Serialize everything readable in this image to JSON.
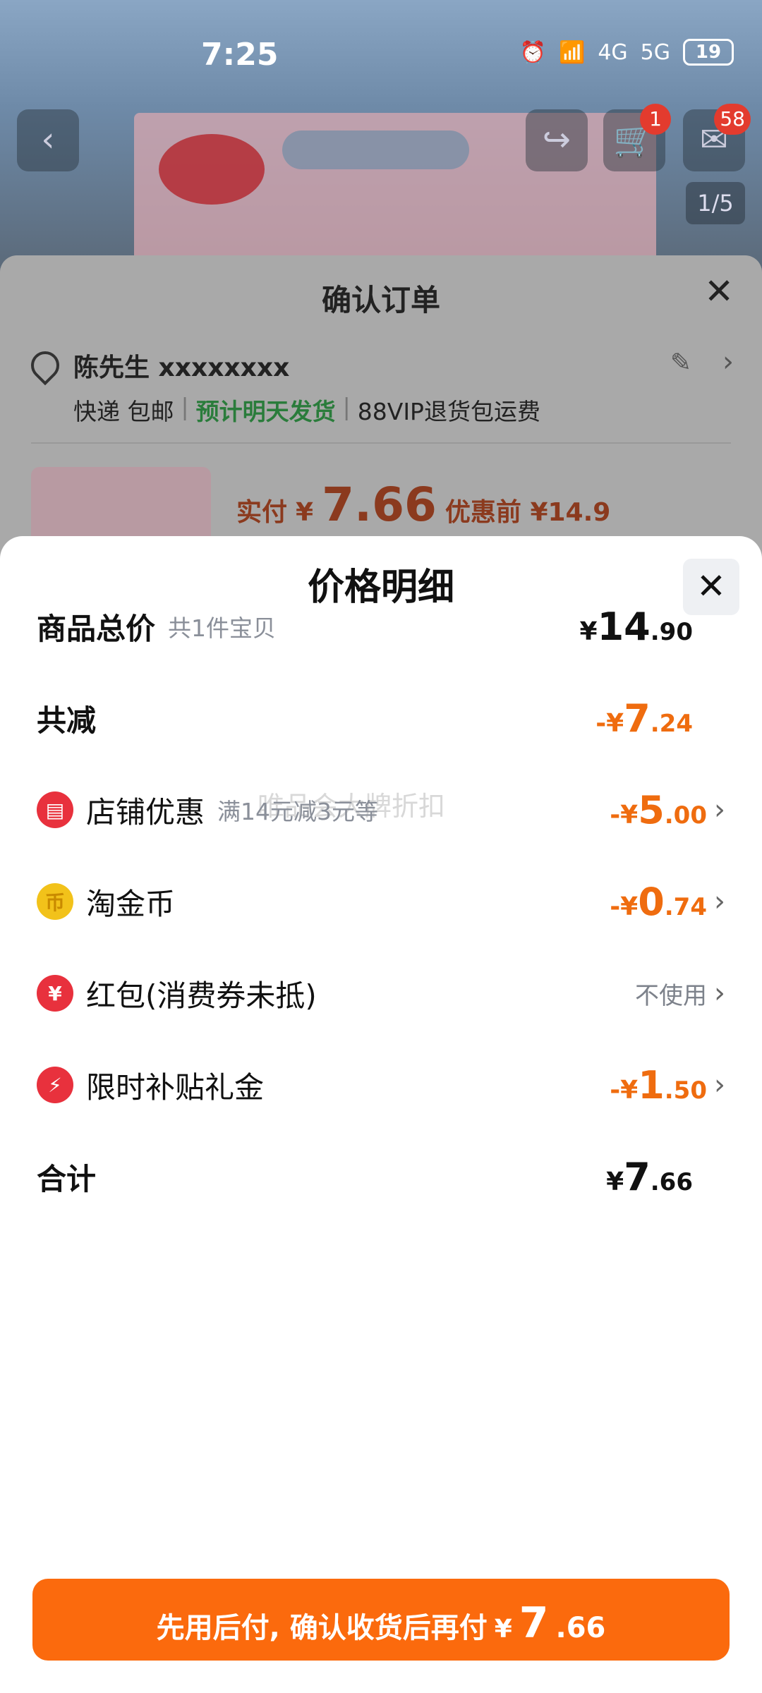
{
  "status_bar": {
    "time": "7:25",
    "battery": "19",
    "signal_labels": [
      "4G",
      "5G"
    ]
  },
  "product_page": {
    "image_counter": "1/5",
    "cart_badge": "1",
    "message_badge": "58"
  },
  "confirm_order": {
    "title": "确认订单",
    "recipient": "陈先生 xxxxxxxx",
    "shipping": {
      "method": "快递 包邮",
      "eta": "预计明天发货",
      "perk": "88VIP退货包运费"
    },
    "pay_label": "实付",
    "pay_currency": "¥",
    "pay_amount": "7.66",
    "pre_discount": "优惠前 ¥14.9"
  },
  "price_detail": {
    "title": "价格明细",
    "watermark": "唯品会大牌折扣",
    "rows": [
      {
        "label": "商品总价",
        "sub": "共1件宝贝",
        "currency": "¥",
        "int": "14",
        "dec": ".90",
        "tone": "dark"
      },
      {
        "label": "共减",
        "sub": "",
        "currency": "-¥",
        "int": "7",
        "dec": ".24",
        "tone": "orange"
      },
      {
        "label": "店铺优惠",
        "sub": "满14元减3元等",
        "currency": "-¥",
        "int": "5",
        "dec": ".00",
        "tone": "orange",
        "icon": "store-icon"
      },
      {
        "label": "淘金币",
        "sub": "",
        "currency": "-¥",
        "int": "0",
        "dec": ".74",
        "tone": "orange",
        "icon": "coin-icon"
      },
      {
        "label": "红包(消费券未抵)",
        "sub": "",
        "value_text": "不使用",
        "icon": "red-packet-icon"
      },
      {
        "label": "限时补贴礼金",
        "sub": "",
        "currency": "-¥",
        "int": "1",
        "dec": ".50",
        "tone": "orange",
        "icon": "bolt-icon"
      },
      {
        "label": "合计",
        "sub": "",
        "currency": "¥",
        "int": "7",
        "dec": ".66",
        "tone": "dark"
      }
    ]
  },
  "cta": {
    "text": "先用后付, 确认收货后再付",
    "currency": "¥",
    "int": "7",
    "dec": ".66"
  },
  "colors": {
    "accent_orange": "#fb6a0d",
    "price_orange": "#ef6c0f",
    "eta_green": "#2a7c3b"
  }
}
